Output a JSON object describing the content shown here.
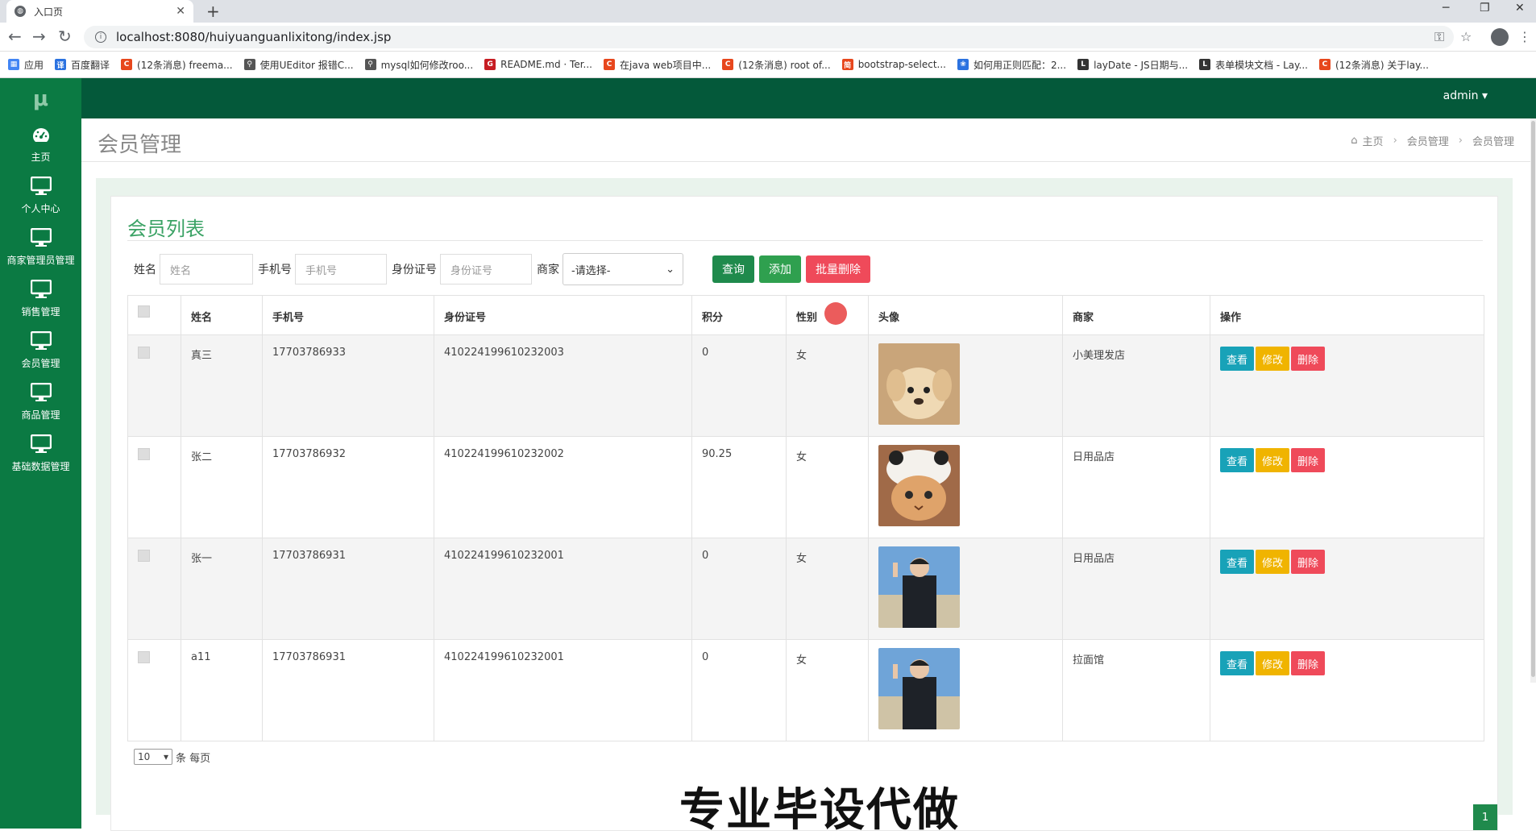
{
  "browser": {
    "tab_title": "入口页",
    "url": "localhost:8080/huiyuanguanlixitong/index.jsp",
    "bookmarks": [
      {
        "label": "应用",
        "color": "#4285f4",
        "glyph": "▦"
      },
      {
        "label": "百度翻译",
        "color": "#2b72e0",
        "glyph": "译"
      },
      {
        "label": "(12条消息) freema...",
        "color": "#e7471d",
        "glyph": "C"
      },
      {
        "label": "使用UEditor 报错C...",
        "color": "#555555",
        "glyph": "⚲"
      },
      {
        "label": "mysql如何修改roo...",
        "color": "#555555",
        "glyph": "⚲"
      },
      {
        "label": "README.md · Ter...",
        "color": "#c71d23",
        "glyph": "G"
      },
      {
        "label": "在java web项目中...",
        "color": "#e7471d",
        "glyph": "C"
      },
      {
        "label": "(12条消息) root of...",
        "color": "#e7471d",
        "glyph": "C"
      },
      {
        "label": "bootstrap-select...",
        "color": "#e7471d",
        "glyph": "简"
      },
      {
        "label": "如何用正则匹配：2...",
        "color": "#2b72e0",
        "glyph": "❀"
      },
      {
        "label": "layDate - JS日期与...",
        "color": "#333333",
        "glyph": "L"
      },
      {
        "label": "表单模块文档 - Lay...",
        "color": "#333333",
        "glyph": "L"
      },
      {
        "label": "(12条消息) 关于lay...",
        "color": "#e7471d",
        "glyph": "C"
      }
    ]
  },
  "app": {
    "logo": "μ",
    "user": "admin ▾",
    "sidebar": [
      {
        "label": "主页",
        "icon": "dashboard-icon"
      },
      {
        "label": "个人中心",
        "icon": "monitor-icon"
      },
      {
        "label": "商家管理员管理",
        "icon": "monitor-icon"
      },
      {
        "label": "销售管理",
        "icon": "monitor-icon"
      },
      {
        "label": "会员管理",
        "icon": "monitor-icon"
      },
      {
        "label": "商品管理",
        "icon": "monitor-icon"
      },
      {
        "label": "基础数据管理",
        "icon": "monitor-icon"
      }
    ],
    "page_title": "会员管理",
    "breadcrumb": {
      "home": "主页",
      "level1": "会员管理",
      "level2": "会员管理"
    },
    "list_title": "会员列表",
    "filters": {
      "name_label": "姓名",
      "name_placeholder": "姓名",
      "phone_label": "手机号",
      "phone_placeholder": "手机号",
      "id_label": "身份证号",
      "id_placeholder": "身份证号",
      "shop_label": "商家",
      "shop_value": "-请选择-"
    },
    "buttons": {
      "query": "查询",
      "add": "添加",
      "batch_delete": "批量删除"
    },
    "columns": [
      "姓名",
      "手机号",
      "身份证号",
      "积分",
      "性别",
      "头像",
      "商家",
      "操作"
    ],
    "rows": [
      {
        "name": "真三",
        "phone": "17703786933",
        "idcard": "410224199610232003",
        "points": "0",
        "gender": "女",
        "avatar": "puppy",
        "shop": "小美理发店"
      },
      {
        "name": "张二",
        "phone": "17703786932",
        "idcard": "410224199610232002",
        "points": "90.25",
        "gender": "女",
        "avatar": "cat",
        "shop": "日用品店"
      },
      {
        "name": "张一",
        "phone": "17703786931",
        "idcard": "410224199610232001",
        "points": "0",
        "gender": "女",
        "avatar": "person",
        "shop": "日用品店"
      },
      {
        "name": "a11",
        "phone": "17703786931",
        "idcard": "410224199610232001",
        "points": "0",
        "gender": "女",
        "avatar": "person",
        "shop": "拉面馆"
      }
    ],
    "row_actions": {
      "view": "查看",
      "edit": "修改",
      "delete": "删除"
    },
    "pager": {
      "page_size": "10",
      "per_page_text": "条 每页",
      "current_page": "1"
    },
    "watermark": "专业毕设代做"
  }
}
